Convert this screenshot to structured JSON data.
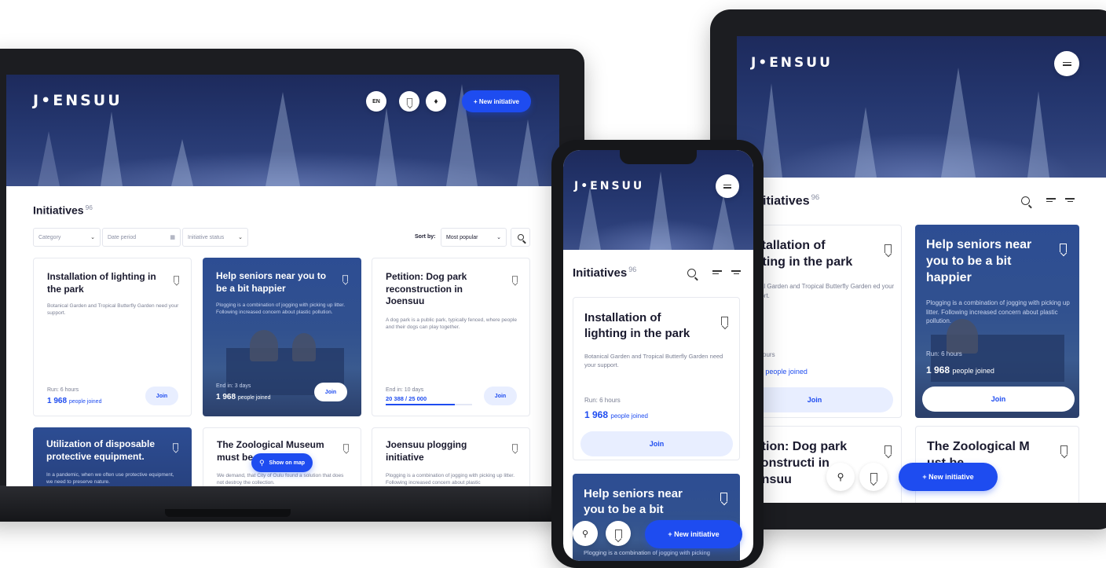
{
  "brand": "J•ENSUU",
  "laptop": {
    "lang": "EN",
    "new_initiative": "+ New initiative",
    "heading": "Initiatives",
    "count": "96",
    "filters": {
      "category": "Category",
      "date": "Date period",
      "status": "Initiative status",
      "sort_label": "Sort by:",
      "sort_value": "Most popular"
    },
    "show_on_map": "Show on map",
    "cards": [
      {
        "title": "Installation of lighting in the park",
        "desc": "Botanical Garden and Tropical Butterfly Garden need your support.",
        "meta": "Run: 6 hours",
        "joined_num": "1 968",
        "joined_txt": "people joined",
        "join": "Join"
      },
      {
        "title": "Help seniors near you to be a bit happier",
        "desc": "Plogging is a combination of jogging with picking up litter. Following increased concern about plastic pollution.",
        "meta": "End in: 3 days",
        "joined_num": "1 968",
        "joined_txt": "people joined",
        "join": "Join"
      },
      {
        "title": "Petition: Dog park reconstruction in Joensuu",
        "desc": "A dog park is a public park, typically fenced, where people and their dogs can play together.",
        "meta": "End in: 10 days",
        "progress": "20 388 / 25 000",
        "progress_frac": 0.8,
        "join": "Join"
      },
      {
        "title": "Utilization of disposable protective equipment.",
        "desc": "In a pandemic, when we often use protective equipment, we need to preserve nature."
      },
      {
        "title": "The Zoological Museum must be",
        "desc": "We demand, that City of Oulu found a solution that does not destroy the collection."
      },
      {
        "title": "Joensuu plogging initiative",
        "desc": "Plogging is a combination of jogging with picking up litter. Following increased concern about plastic"
      }
    ]
  },
  "phone": {
    "heading": "Initiatives",
    "count": "96",
    "card1": {
      "title": "Installation of lighting in the park",
      "desc": "Botanical Garden and Tropical Butterfly Garden need your support.",
      "meta": "Run: 6 hours",
      "joined_num": "1 968",
      "joined_txt": "people joined",
      "join": "Join"
    },
    "card2": {
      "title": "Help seniors near you to be a bit",
      "desc": "Plogging is a combination of jogging with picking"
    },
    "new_initiative": "+ New initiative"
  },
  "tablet": {
    "heading": "itiatives",
    "count": "96",
    "card1": {
      "title": "nstallation of ghting in the park",
      "desc": "tanical Garden and Tropical Butterfly Garden ed your support.",
      "meta": "n: 6 hours",
      "joined_num": "968",
      "joined_txt": "people joined",
      "join": "Join"
    },
    "card2": {
      "title": "Help seniors near you to be a bit happier",
      "desc": "Plogging is a combination of jogging with picking up litter. Following increased concern about plastic pollution.",
      "meta": "Run: 6 hours",
      "joined_num": "1 968",
      "joined_txt": "people joined",
      "join": "Join"
    },
    "card3": {
      "title": "etition: Dog park econstructi in oensuu"
    },
    "card4": {
      "title": "The Zoological M ust be"
    },
    "new_initiative": "+ New initiative"
  }
}
